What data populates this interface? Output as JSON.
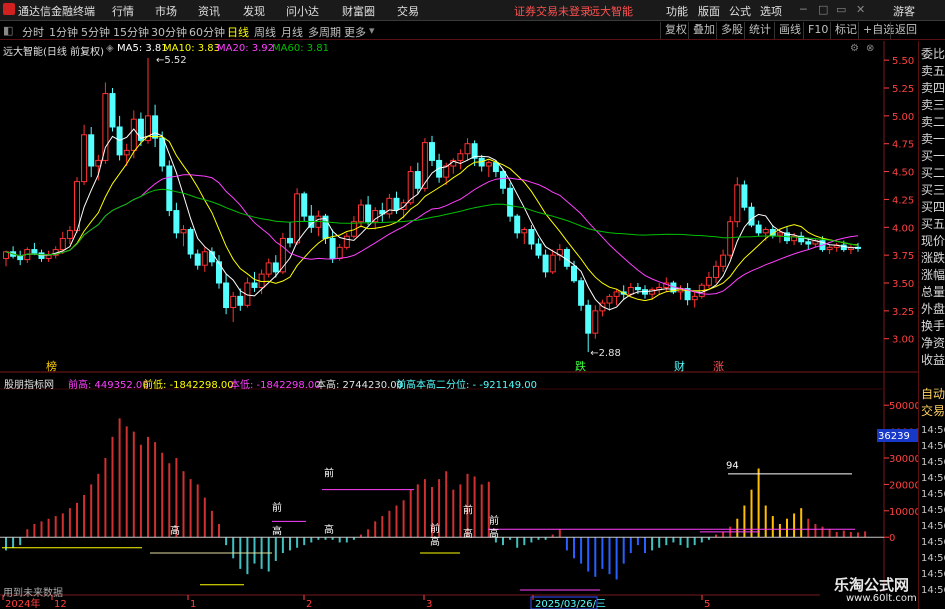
{
  "app": {
    "title": "通达信金融终端",
    "alert": "证券交易未登录",
    "stock": "远大智能",
    "guest": "游客"
  },
  "menu": [
    "行情",
    "市场",
    "资讯",
    "发现",
    "问小达",
    "财富圈",
    "交易"
  ],
  "menu_right": [
    "功能",
    "版面",
    "公式",
    "选项"
  ],
  "periods": [
    "分时",
    "1分钟",
    "5分钟",
    "15分钟",
    "30分钟",
    "60分钟",
    "日线",
    "周线",
    "月线",
    "多周期",
    "更多"
  ],
  "active_period": "日线",
  "toolbar_right": [
    "复权",
    "叠加",
    "多股",
    "统计",
    "画线",
    "F10",
    "标记",
    "+自选",
    "返回"
  ],
  "main_legend": {
    "title": "远大智能(日线 前复权)",
    "ma5": "MA5: 3.81",
    "ma10": "MA10: 3.83",
    "ma20": "MA20: 3.92",
    "ma60": "MA60: 3.81"
  },
  "price_axis": [
    "5.50",
    "5.25",
    "5.00",
    "4.75",
    "4.50",
    "4.25",
    "4.00",
    "3.75",
    "3.50",
    "3.25",
    "3.00"
  ],
  "price_labels": {
    "high": "5.52",
    "low": "2.88"
  },
  "event_marks": [
    "榜",
    "跌",
    "财",
    "涨"
  ],
  "ind_legend": {
    "title": "股朋指标网",
    "qg": "前高: 449352.00",
    "qd": "前低: -1842298.00",
    "bd": "本低: -1842298.00",
    "bg": "本高: 2744230.00",
    "fw": "前高本高二分位: - -921149.00"
  },
  "ind_axis": [
    "50000",
    "40000",
    "30000",
    "20000",
    "10000",
    "0"
  ],
  "ind_badge": "36239",
  "ind_text": {
    "qian": "前",
    "gao": "高",
    "value": "94"
  },
  "note": "用到未来数据",
  "date_axis": [
    "2024年",
    "12",
    "1",
    "2",
    "3",
    "2025/03/26/三",
    "5"
  ],
  "watermark": {
    "name": "乐淘公式网",
    "url": "www.60lt.com"
  },
  "sidebar": [
    "委比",
    "卖五",
    "卖四",
    "卖三",
    "卖二",
    "卖一",
    "买一",
    "买二",
    "买三",
    "买四",
    "买五",
    "现价",
    "涨跌",
    "涨幅",
    "总量",
    "外盘",
    "换手",
    "净资",
    "收益",
    "自动",
    "交易"
  ],
  "ticks": [
    "14:56",
    "14:56",
    "14:56",
    "14:56",
    "14:56",
    "14:56",
    "14:56",
    "14:56",
    "14:56",
    "14:56",
    "14:56"
  ],
  "colors": {
    "up": "#ff3232",
    "down": "#54ffff",
    "ma5": "#ffffff",
    "ma10": "#ffff00",
    "ma20": "#ff40ff",
    "ma60": "#00c000"
  },
  "chart_data": {
    "type": "candlestick",
    "y_range": [
      2.8,
      5.6
    ],
    "ohlc": [
      [
        3.72,
        3.79,
        3.65,
        3.78
      ],
      [
        3.78,
        3.83,
        3.72,
        3.74
      ],
      [
        3.74,
        3.79,
        3.66,
        3.71
      ],
      [
        3.71,
        3.82,
        3.68,
        3.8
      ],
      [
        3.8,
        3.86,
        3.75,
        3.77
      ],
      [
        3.77,
        3.8,
        3.69,
        3.72
      ],
      [
        3.72,
        3.79,
        3.69,
        3.75
      ],
      [
        3.75,
        3.83,
        3.72,
        3.8
      ],
      [
        3.8,
        3.96,
        3.76,
        3.9
      ],
      [
        3.9,
        4.01,
        3.85,
        3.97
      ],
      [
        3.97,
        4.45,
        3.95,
        4.41
      ],
      [
        4.41,
        4.92,
        4.38,
        4.83
      ],
      [
        4.83,
        4.9,
        4.45,
        4.55
      ],
      [
        4.55,
        4.65,
        4.42,
        4.6
      ],
      [
        4.6,
        5.3,
        4.57,
        5.2
      ],
      [
        5.2,
        5.25,
        4.86,
        4.9
      ],
      [
        4.9,
        5.0,
        4.6,
        4.65
      ],
      [
        4.65,
        4.75,
        4.55,
        4.69
      ],
      [
        4.69,
        5.05,
        4.62,
        4.97
      ],
      [
        4.97,
        5.03,
        4.73,
        4.78
      ],
      [
        4.78,
        5.52,
        4.75,
        5.0
      ],
      [
        5.0,
        5.1,
        4.72,
        4.8
      ],
      [
        4.8,
        4.86,
        4.5,
        4.55
      ],
      [
        4.55,
        4.6,
        4.1,
        4.15
      ],
      [
        4.15,
        4.22,
        3.9,
        3.95
      ],
      [
        3.95,
        4.02,
        3.83,
        3.98
      ],
      [
        3.98,
        4.0,
        3.72,
        3.76
      ],
      [
        3.76,
        3.8,
        3.62,
        3.66
      ],
      [
        3.66,
        3.82,
        3.6,
        3.78
      ],
      [
        3.78,
        3.82,
        3.65,
        3.69
      ],
      [
        3.69,
        3.75,
        3.45,
        3.5
      ],
      [
        3.5,
        3.58,
        3.22,
        3.28
      ],
      [
        3.28,
        3.42,
        3.15,
        3.38
      ],
      [
        3.38,
        3.45,
        3.25,
        3.3
      ],
      [
        3.3,
        3.55,
        3.28,
        3.5
      ],
      [
        3.5,
        3.6,
        3.42,
        3.46
      ],
      [
        3.46,
        3.62,
        3.4,
        3.58
      ],
      [
        3.58,
        3.72,
        3.55,
        3.68
      ],
      [
        3.68,
        3.75,
        3.55,
        3.6
      ],
      [
        3.6,
        3.95,
        3.58,
        3.9
      ],
      [
        3.9,
        4.05,
        3.82,
        3.86
      ],
      [
        3.86,
        4.35,
        3.84,
        4.3
      ],
      [
        4.3,
        4.32,
        4.05,
        4.1
      ],
      [
        4.1,
        4.2,
        3.95,
        4.0
      ],
      [
        4.0,
        4.15,
        3.92,
        4.1
      ],
      [
        4.1,
        4.12,
        3.85,
        3.9
      ],
      [
        3.9,
        3.98,
        3.68,
        3.72
      ],
      [
        3.72,
        3.85,
        3.7,
        3.82
      ],
      [
        3.82,
        3.95,
        3.8,
        3.92
      ],
      [
        3.92,
        4.1,
        3.9,
        4.05
      ],
      [
        4.05,
        4.25,
        4.0,
        4.2
      ],
      [
        4.2,
        4.28,
        4.02,
        4.05
      ],
      [
        4.05,
        4.18,
        3.98,
        4.15
      ],
      [
        4.15,
        4.22,
        4.05,
        4.12
      ],
      [
        4.12,
        4.3,
        4.08,
        4.26
      ],
      [
        4.26,
        4.32,
        4.12,
        4.16
      ],
      [
        4.16,
        4.25,
        4.08,
        4.22
      ],
      [
        4.22,
        4.55,
        4.2,
        4.5
      ],
      [
        4.5,
        4.58,
        4.3,
        4.35
      ],
      [
        4.35,
        4.8,
        4.32,
        4.76
      ],
      [
        4.76,
        4.82,
        4.55,
        4.6
      ],
      [
        4.6,
        4.66,
        4.4,
        4.45
      ],
      [
        4.45,
        4.58,
        4.38,
        4.55
      ],
      [
        4.55,
        4.62,
        4.48,
        4.6
      ],
      [
        4.6,
        4.7,
        4.52,
        4.66
      ],
      [
        4.66,
        4.8,
        4.6,
        4.75
      ],
      [
        4.75,
        4.78,
        4.55,
        4.62
      ],
      [
        4.62,
        4.65,
        4.5,
        4.55
      ],
      [
        4.55,
        4.6,
        4.45,
        4.58
      ],
      [
        4.58,
        4.6,
        4.45,
        4.5
      ],
      [
        4.5,
        4.52,
        4.3,
        4.35
      ],
      [
        4.35,
        4.4,
        4.05,
        4.1
      ],
      [
        4.1,
        4.12,
        3.9,
        3.95
      ],
      [
        3.95,
        4.0,
        3.85,
        3.98
      ],
      [
        3.98,
        4.02,
        3.8,
        3.85
      ],
      [
        3.85,
        3.9,
        3.72,
        3.75
      ],
      [
        3.75,
        3.8,
        3.55,
        3.6
      ],
      [
        3.6,
        3.8,
        3.58,
        3.75
      ],
      [
        3.75,
        3.85,
        3.7,
        3.8
      ],
      [
        3.8,
        3.82,
        3.62,
        3.65
      ],
      [
        3.65,
        3.7,
        3.5,
        3.52
      ],
      [
        3.52,
        3.55,
        3.25,
        3.3
      ],
      [
        3.3,
        3.35,
        2.88,
        3.05
      ],
      [
        3.05,
        3.3,
        3.0,
        3.25
      ],
      [
        3.25,
        3.35,
        3.2,
        3.32
      ],
      [
        3.32,
        3.4,
        3.25,
        3.38
      ],
      [
        3.38,
        3.45,
        3.3,
        3.42
      ],
      [
        3.42,
        3.48,
        3.35,
        3.4
      ],
      [
        3.4,
        3.5,
        3.38,
        3.46
      ],
      [
        3.46,
        3.5,
        3.4,
        3.44
      ],
      [
        3.44,
        3.48,
        3.36,
        3.4
      ],
      [
        3.4,
        3.46,
        3.35,
        3.44
      ],
      [
        3.44,
        3.5,
        3.4,
        3.46
      ],
      [
        3.46,
        3.55,
        3.42,
        3.5
      ],
      [
        3.5,
        3.52,
        3.4,
        3.42
      ],
      [
        3.42,
        3.48,
        3.35,
        3.45
      ],
      [
        3.45,
        3.5,
        3.3,
        3.35
      ],
      [
        3.35,
        3.42,
        3.28,
        3.38
      ],
      [
        3.38,
        3.5,
        3.36,
        3.48
      ],
      [
        3.48,
        3.6,
        3.45,
        3.55
      ],
      [
        3.55,
        3.7,
        3.5,
        3.65
      ],
      [
        3.65,
        3.8,
        3.6,
        3.75
      ],
      [
        3.75,
        4.1,
        3.72,
        4.05
      ],
      [
        4.05,
        4.45,
        4.0,
        4.38
      ],
      [
        4.38,
        4.42,
        4.15,
        4.18
      ],
      [
        4.18,
        4.22,
        4.0,
        4.02
      ],
      [
        4.02,
        4.06,
        3.92,
        3.95
      ],
      [
        3.95,
        4.0,
        3.88,
        3.98
      ],
      [
        3.98,
        4.02,
        3.9,
        3.93
      ],
      [
        3.93,
        3.98,
        3.86,
        3.95
      ],
      [
        3.95,
        4.0,
        3.85,
        3.88
      ],
      [
        3.88,
        3.95,
        3.84,
        3.92
      ],
      [
        3.92,
        3.96,
        3.84,
        3.87
      ],
      [
        3.87,
        3.9,
        3.8,
        3.85
      ],
      [
        3.85,
        3.9,
        3.82,
        3.88
      ],
      [
        3.88,
        3.92,
        3.78,
        3.8
      ],
      [
        3.8,
        3.84,
        3.76,
        3.82
      ],
      [
        3.82,
        3.86,
        3.78,
        3.84
      ],
      [
        3.84,
        3.88,
        3.78,
        3.8
      ],
      [
        3.8,
        3.84,
        3.76,
        3.82
      ],
      [
        3.82,
        3.86,
        3.78,
        3.81
      ]
    ],
    "indicator": [
      -5000,
      -4000,
      -3000,
      3000,
      5000,
      6000,
      7000,
      8000,
      9000,
      11000,
      13000,
      16000,
      20000,
      24000,
      30000,
      38000,
      45000,
      42000,
      40000,
      35000,
      38000,
      36000,
      32000,
      28000,
      30000,
      25000,
      22000,
      20000,
      15000,
      10000,
      5000,
      -3000,
      -8000,
      -12000,
      -14000,
      -10000,
      -12000,
      -13000,
      -9000,
      -6000,
      -5000,
      -4000,
      -3000,
      -2000,
      -1000,
      -1000,
      -1000,
      -2000,
      -2000,
      -1000,
      1000,
      3000,
      6000,
      8000,
      10000,
      12000,
      14000,
      18000,
      20000,
      22000,
      19000,
      22000,
      25000,
      18000,
      20000,
      24000,
      23000,
      20000,
      21000,
      -2000,
      -3000,
      -1000,
      -4000,
      -3000,
      -2000,
      -1000,
      -1000,
      1000,
      3000,
      -5000,
      -8000,
      -10000,
      -13000,
      -15000,
      -12000,
      -14000,
      -16000,
      -10000,
      -6000,
      -3000,
      -6000,
      -5000,
      -4000,
      -3000,
      -2000,
      -3000,
      -4000,
      -3000,
      -2000,
      -1000,
      1000,
      2000,
      4000,
      7000,
      12000,
      18000,
      26000,
      12000,
      8000,
      5000,
      7000,
      9000,
      11000,
      7000,
      5000,
      4000,
      3000,
      2000,
      2500,
      2000,
      1800,
      2200
    ]
  }
}
